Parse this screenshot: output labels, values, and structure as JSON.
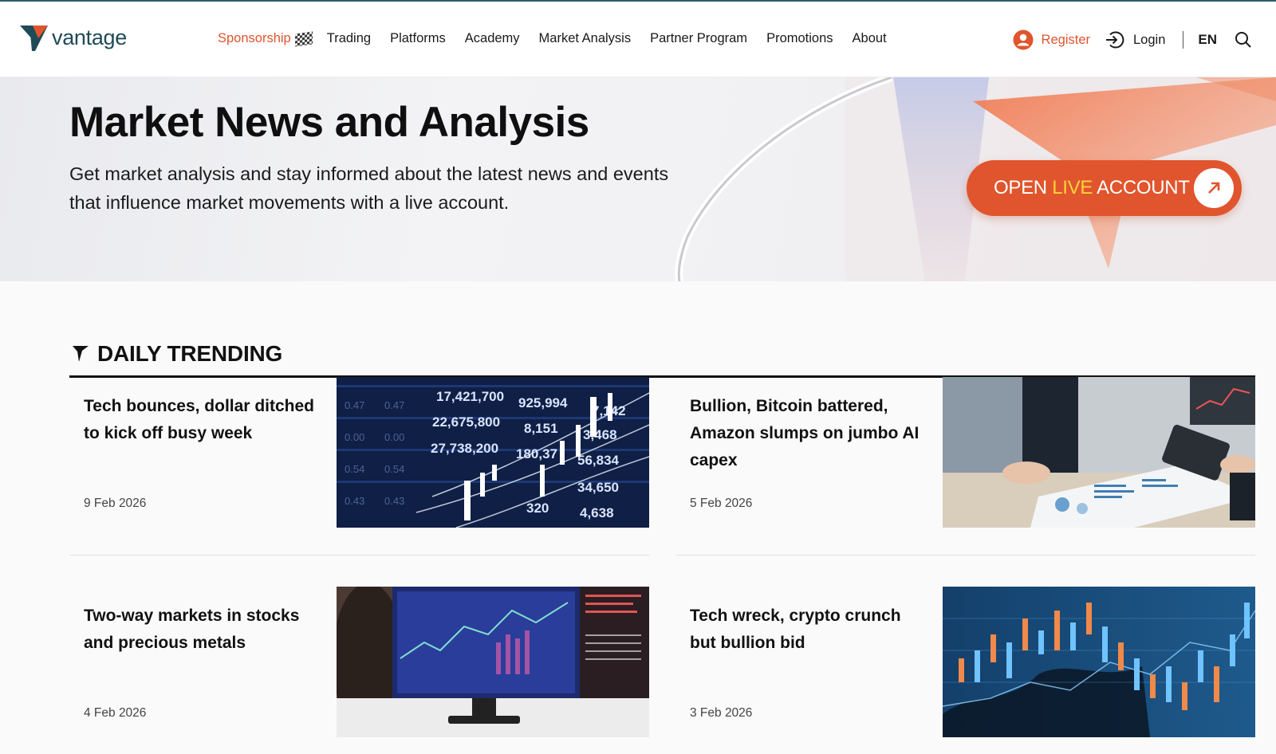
{
  "brand": {
    "name": "vantage",
    "accent": "#e0552d",
    "teal": "#1f4a57"
  },
  "nav": {
    "sponsorship": "Sponsorship",
    "items": [
      "Trading",
      "Platforms",
      "Academy",
      "Market Analysis",
      "Partner Program",
      "Promotions",
      "About"
    ]
  },
  "account": {
    "register": "Register",
    "login": "Login",
    "language": "EN"
  },
  "icons": {
    "register": "user-circle-icon",
    "login": "sign-in-icon",
    "search": "search-icon",
    "flag": "checkered-flag-icon",
    "trending": "trending-arrow-icon",
    "cta": "arrow-up-right-icon"
  },
  "hero": {
    "title": "Market News and Analysis",
    "description": "Get market analysis and stay informed about the latest news and events that influence market movements with a live account.",
    "cta": {
      "open": "OPEN",
      "live": "LIVE",
      "account": "ACCOUNT"
    }
  },
  "trending": {
    "heading": "DAILY TRENDING",
    "articles": [
      {
        "title": "Tech bounces, dollar ditched to kick off busy week",
        "date": "9 Feb 2026",
        "image": "stock-ticker-board"
      },
      {
        "title": "Bullion, Bitcoin battered, Amazon slumps on jumbo AI capex",
        "date": "5 Feb 2026",
        "image": "business-meeting-charts"
      },
      {
        "title": "Two-way markets in stocks and precious metals",
        "date": "4 Feb 2026",
        "image": "trader-monitors"
      },
      {
        "title": "Tech wreck, crypto crunch but bullion bid",
        "date": "3 Feb 2026",
        "image": "candlestick-world-map"
      }
    ]
  },
  "ticker_numbers": [
    "17,421,700",
    "925,994",
    "22,675,800",
    "8,151",
    "27,738,200",
    "180,37",
    "56,834",
    "3,468",
    "34,650",
    "320",
    "4,638",
    "7,142"
  ]
}
